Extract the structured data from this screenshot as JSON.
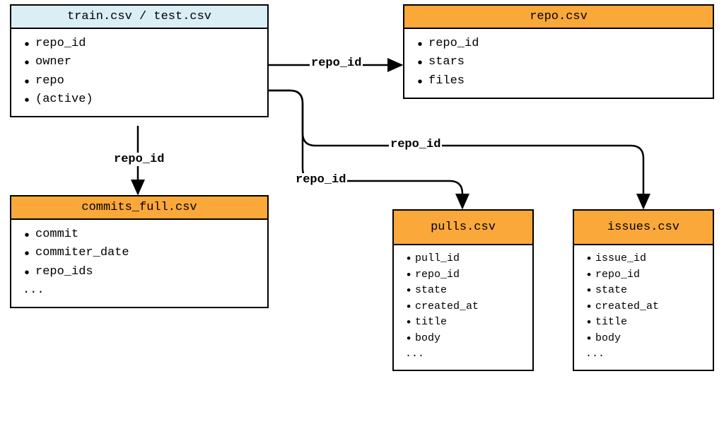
{
  "entities": {
    "train": {
      "title": "train.csv / test.csv",
      "fields": [
        "repo_id",
        "owner",
        "repo",
        "(active)"
      ]
    },
    "repo": {
      "title": "repo.csv",
      "fields": [
        "repo_id",
        "stars",
        "files"
      ]
    },
    "commits": {
      "title": "commits_full.csv",
      "fields": [
        "commit",
        "commiter_date",
        "repo_ids"
      ],
      "ellipsis": "..."
    },
    "pulls": {
      "title": "pulls.csv",
      "fields": [
        "pull_id",
        "repo_id",
        "state",
        "created_at",
        "title",
        "body"
      ],
      "ellipsis": "..."
    },
    "issues": {
      "title": "issues.csv",
      "fields": [
        "issue_id",
        "repo_id",
        "state",
        "created_at",
        "title",
        "body"
      ],
      "ellipsis": "..."
    }
  },
  "edges": {
    "to_repo": "repo_id",
    "to_commits": "repo_id",
    "to_pulls": "repo_id",
    "to_issues": "repo_id"
  }
}
